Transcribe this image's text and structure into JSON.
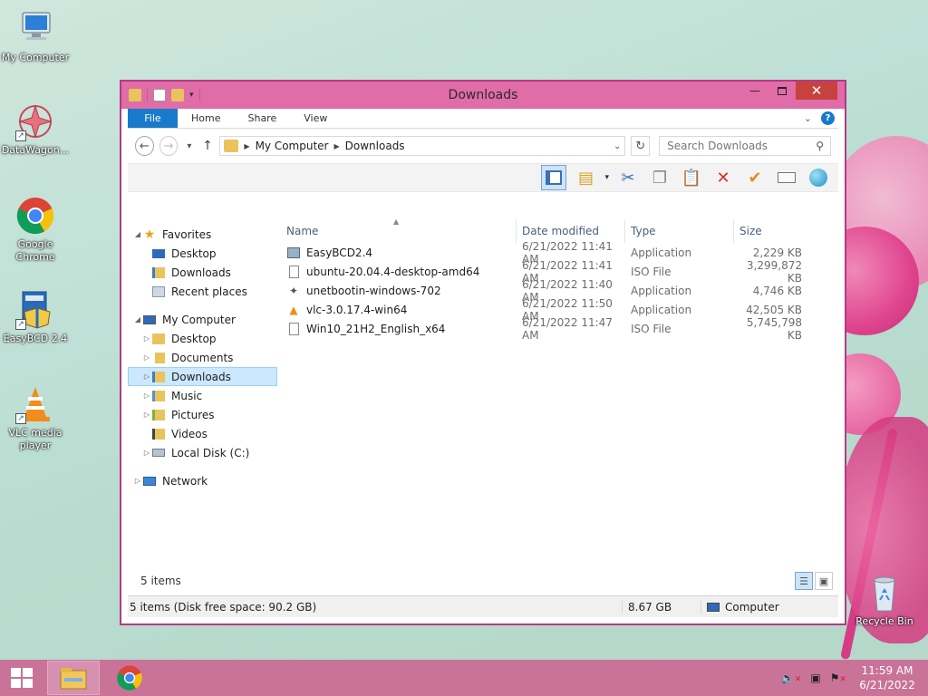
{
  "desktop": {
    "icons": [
      {
        "label": "My Computer"
      },
      {
        "label": "DataWagon..."
      },
      {
        "label": "Google Chrome"
      },
      {
        "label": "EasyBCD 2.4"
      },
      {
        "label": "VLC media player"
      },
      {
        "label": "Recycle Bin"
      }
    ]
  },
  "window": {
    "title": "Downloads",
    "ribbon_tabs": [
      "File",
      "Home",
      "Share",
      "View"
    ],
    "help_label": "?",
    "address": {
      "crumbs": [
        "My Computer",
        "Downloads"
      ]
    },
    "search": {
      "placeholder": "Search Downloads"
    }
  },
  "navpane": {
    "favorites": {
      "label": "Favorites",
      "items": [
        "Desktop",
        "Downloads",
        "Recent places"
      ]
    },
    "computer": {
      "label": "My Computer",
      "items": [
        "Desktop",
        "Documents",
        "Downloads",
        "Music",
        "Pictures",
        "Videos",
        "Local Disk (C:)"
      ]
    },
    "network": {
      "label": "Network"
    }
  },
  "files": {
    "columns": [
      "Name",
      "Date modified",
      "Type",
      "Size"
    ],
    "rows": [
      {
        "name": "EasyBCD2.4",
        "date": "6/21/2022 11:41 AM",
        "type": "Application",
        "size": "2,229 KB",
        "icon": "installer-icon"
      },
      {
        "name": "ubuntu-20.04.4-desktop-amd64",
        "date": "6/21/2022 11:41 AM",
        "type": "ISO File",
        "size": "3,299,872 KB",
        "icon": "disc-image-icon"
      },
      {
        "name": "unetbootin-windows-702",
        "date": "6/21/2022 11:40 AM",
        "type": "Application",
        "size": "4,746 KB",
        "icon": "unetbootin-icon"
      },
      {
        "name": "vlc-3.0.17.4-win64",
        "date": "6/21/2022 11:50 AM",
        "type": "Application",
        "size": "42,505 KB",
        "icon": "vlc-cone-icon"
      },
      {
        "name": "Win10_21H2_English_x64",
        "date": "6/21/2022 11:47 AM",
        "type": "ISO File",
        "size": "5,745,798 KB",
        "icon": "disc-image-icon"
      }
    ]
  },
  "status": {
    "item_count": "5 items",
    "details_left": "5 items (Disk free space: 90.2 GB)",
    "details_size": "8.67 GB",
    "details_location": "Computer"
  },
  "taskbar": {
    "time": "11:59 AM",
    "date": "6/21/2022"
  }
}
